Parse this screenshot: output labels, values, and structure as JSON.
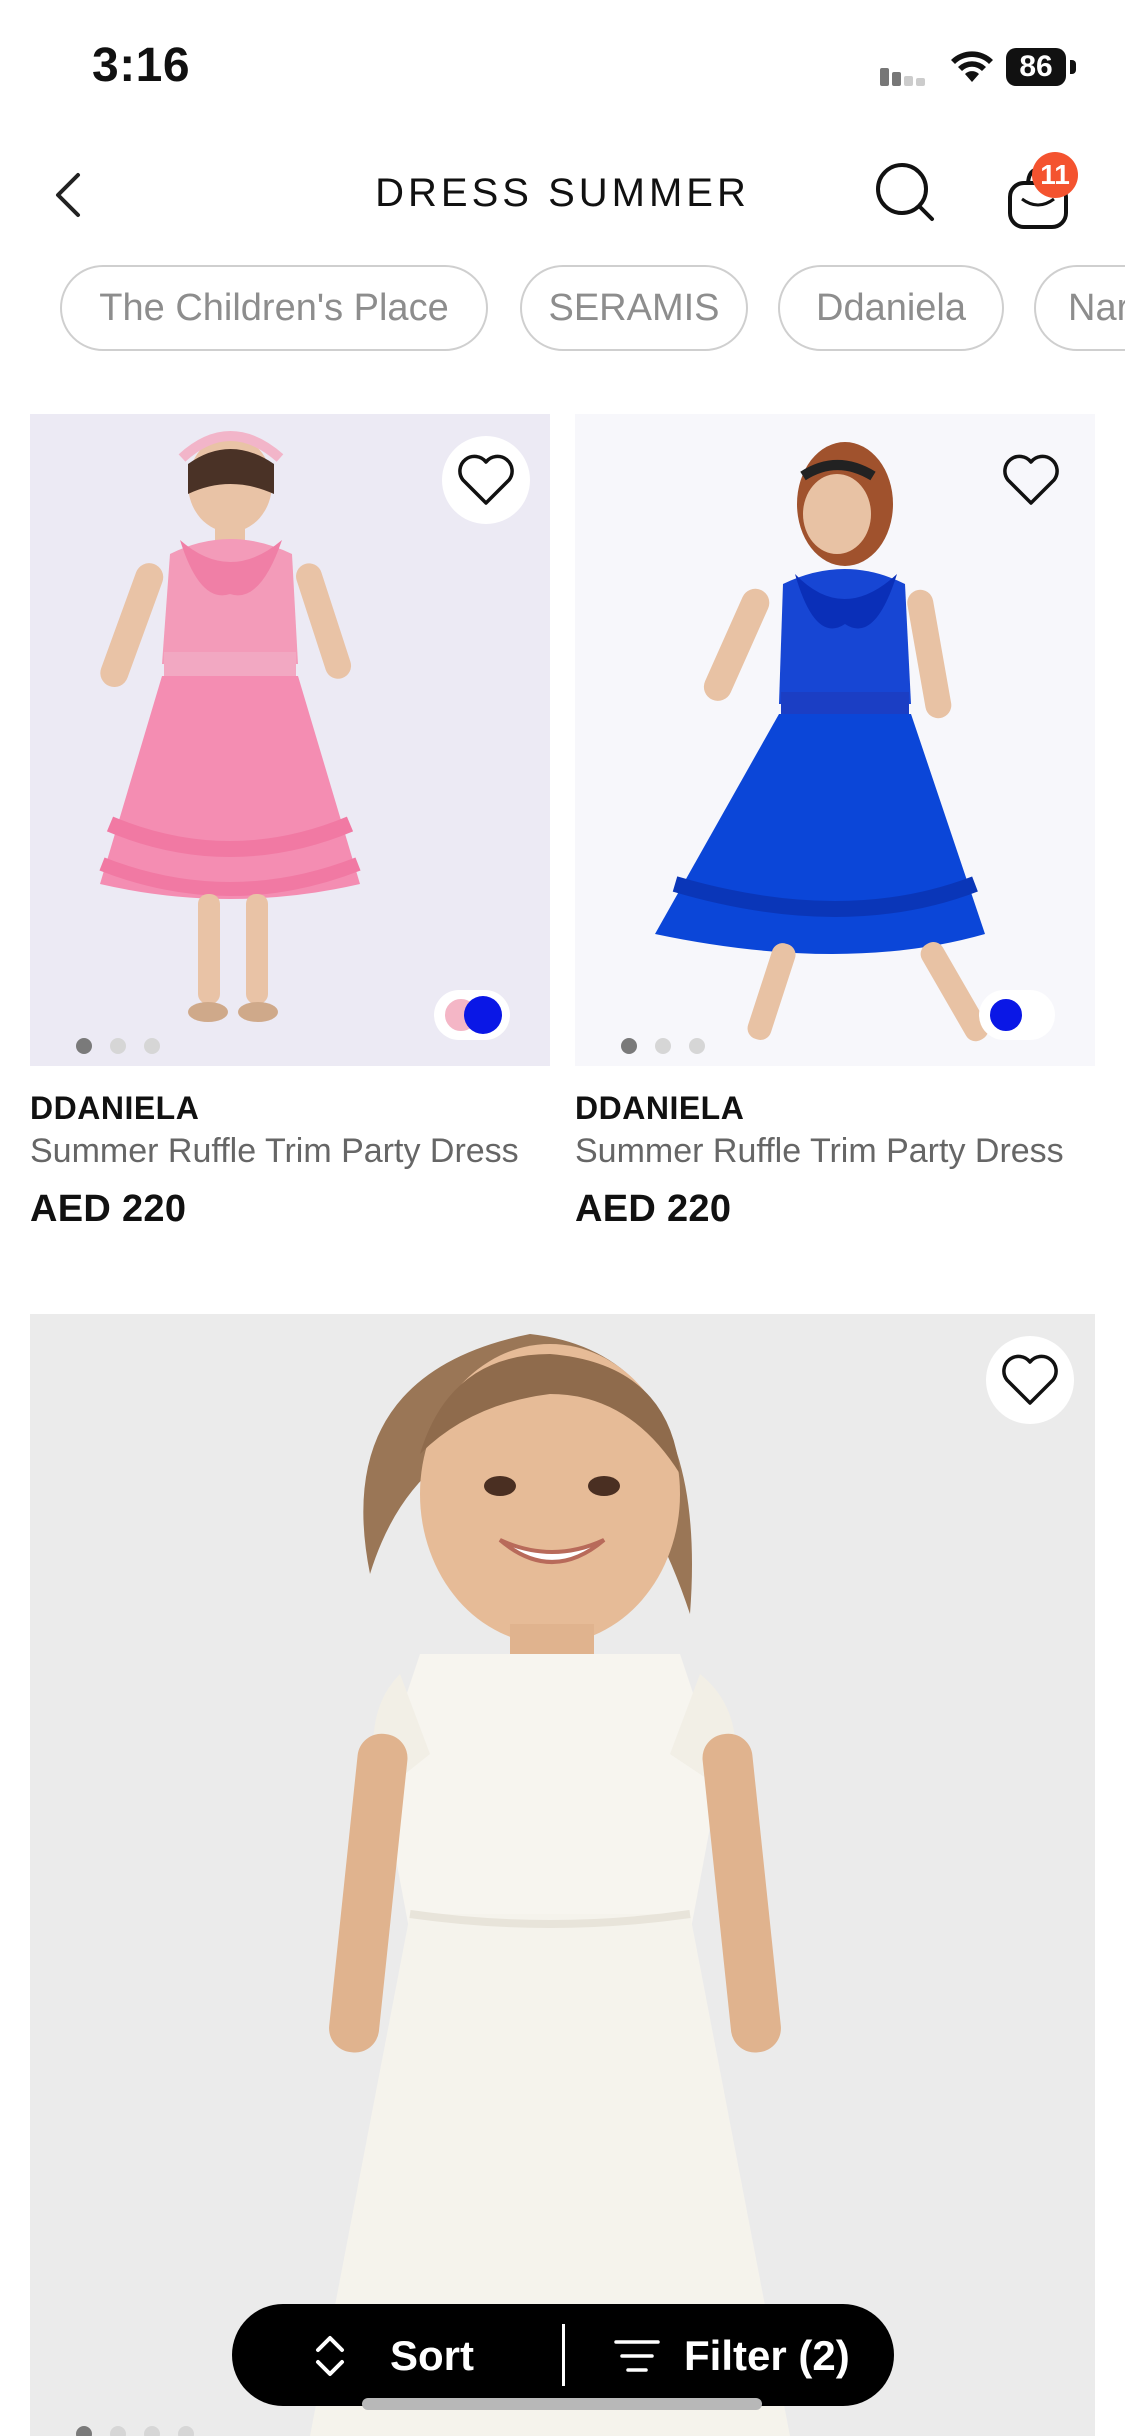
{
  "status_bar": {
    "time": "3:16",
    "battery": "86"
  },
  "header": {
    "title": "DRESS SUMMER",
    "cart_count": "11"
  },
  "chips": [
    "The Children's Place",
    "SERAMIS",
    "Ddaniela",
    "Nar"
  ],
  "products": [
    {
      "brand": "DDANIELA",
      "name": "Summer Ruffle Trim Party Dress",
      "price": "AED 220",
      "swatches": [
        "#f4b6c6",
        "#0a17e6"
      ]
    },
    {
      "brand": "DDANIELA",
      "name": "Summer Ruffle Trim Party Dress",
      "price": "AED 220",
      "swatches": [
        "#0a17e6",
        "#f4b6c6"
      ]
    }
  ],
  "bottom_bar": {
    "sort_label": "Sort",
    "filter_label": "Filter (2)"
  },
  "colors": {
    "badge": "#f4532f",
    "pink_dress": "#f08fb0",
    "blue_dress": "#0b46d8"
  }
}
